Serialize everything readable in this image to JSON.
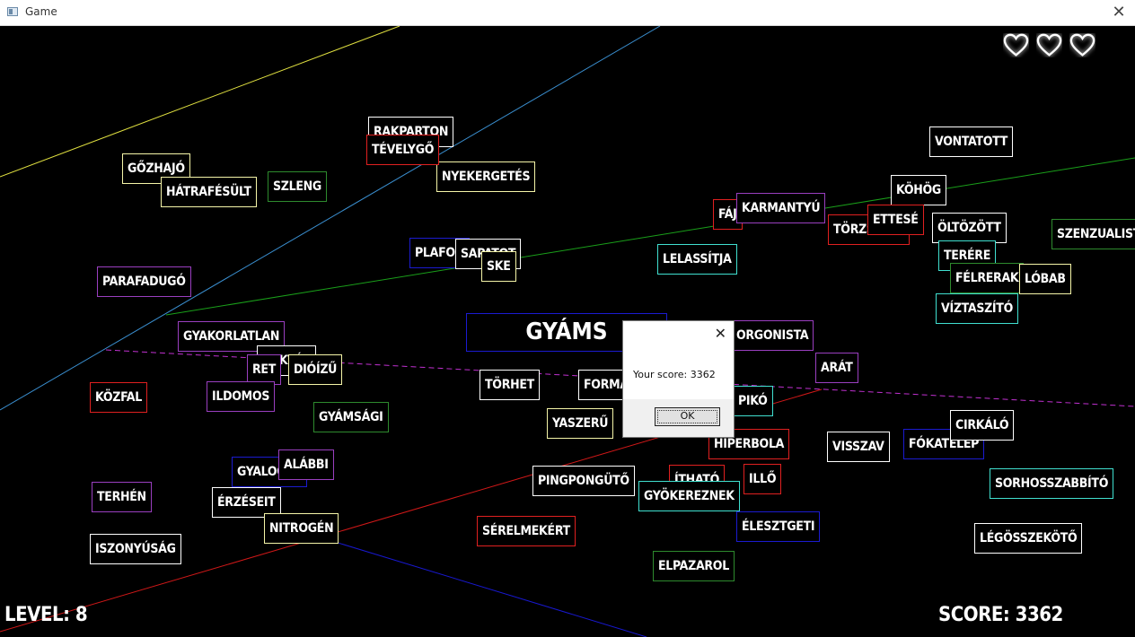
{
  "window": {
    "title": "Game",
    "close_glyph": "✕"
  },
  "hud": {
    "level_text": "LEVEL: 8",
    "score_text": "SCORE: 3362",
    "lives": 3,
    "heart_icon": "heart-outline-icon"
  },
  "current_word": "GYÁMS",
  "dialog": {
    "message": "Your score: 3362",
    "ok_label": "OK",
    "close_glyph": "✕"
  },
  "colors": {
    "background": "#000000",
    "white": "#ffffff",
    "yellow": "#f5f5a8",
    "green": "#2e8b2e",
    "red": "#e02020",
    "purple": "#9a3fc0",
    "cyan": "#40e0d0",
    "blue": "#1b1bd0"
  },
  "words": [
    {
      "text": "RAKPARTON",
      "color": "white"
    },
    {
      "text": "NYEKERGETÉS",
      "color": "yellow"
    },
    {
      "text": "TÉVELYGŐ",
      "color": "red"
    },
    {
      "text": "GŐZHAJÓ",
      "color": "yellow"
    },
    {
      "text": "HÁTRAFÉSÜLT",
      "color": "yellow"
    },
    {
      "text": "SZLENG",
      "color": "green"
    },
    {
      "text": "VONTATOTT",
      "color": "white"
    },
    {
      "text": "KÖHÖG",
      "color": "white"
    },
    {
      "text": "FÁJ",
      "color": "red"
    },
    {
      "text": "KARMANTYÚ",
      "color": "purple"
    },
    {
      "text": "TÖRZSHELY",
      "color": "red"
    },
    {
      "text": "ETTESÉ",
      "color": "red"
    },
    {
      "text": "ÖLTÖZÖTT",
      "color": "white"
    },
    {
      "text": "SZENZUALISTA",
      "color": "green"
    },
    {
      "text": "TERÉRE",
      "color": "cyan"
    },
    {
      "text": "FÉLRERAK",
      "color": "green"
    },
    {
      "text": "LÓBAB",
      "color": "yellow"
    },
    {
      "text": "VÍZTASZÍTÓ",
      "color": "cyan"
    },
    {
      "text": "PLAFON",
      "color": "blue"
    },
    {
      "text": "SAPATOT",
      "color": "white"
    },
    {
      "text": "SKE",
      "color": "yellow"
    },
    {
      "text": "LELASSÍTJA",
      "color": "cyan"
    },
    {
      "text": "PARAFADUGÓ",
      "color": "purple"
    },
    {
      "text": "GYAKORLATLAN",
      "color": "purple"
    },
    {
      "text": "RAKTÉR",
      "color": "white"
    },
    {
      "text": "RET",
      "color": "purple"
    },
    {
      "text": "DIÓÍZŰ",
      "color": "yellow"
    },
    {
      "text": "KÖZFAL",
      "color": "red"
    },
    {
      "text": "ILDOMOS",
      "color": "purple"
    },
    {
      "text": "GYÁMSÁGI",
      "color": "green"
    },
    {
      "text": "TÖRHET",
      "color": "white"
    },
    {
      "text": "FORMÁLISAN",
      "color": "white"
    },
    {
      "text": "YASZERŰ",
      "color": "yellow"
    },
    {
      "text": "ORGONISTA",
      "color": "purple"
    },
    {
      "text": "ARÁT",
      "color": "purple"
    },
    {
      "text": "PIKÓ",
      "color": "cyan"
    },
    {
      "text": "HIPERBOLA",
      "color": "red"
    },
    {
      "text": "VISSZAV",
      "color": "white"
    },
    {
      "text": "FÓKATELEP",
      "color": "blue"
    },
    {
      "text": "CIRKÁLÓ",
      "color": "white"
    },
    {
      "text": "SORHOSSZABBÍTÓ",
      "color": "cyan"
    },
    {
      "text": "TERHÉN",
      "color": "purple"
    },
    {
      "text": "GYALOGOL",
      "color": "blue"
    },
    {
      "text": "ALÁBBI",
      "color": "purple"
    },
    {
      "text": "ÉRZÉSEIT",
      "color": "white"
    },
    {
      "text": "NITROGÉN",
      "color": "yellow"
    },
    {
      "text": "PINGPONGÜTŐ",
      "color": "white"
    },
    {
      "text": "ÍTHATÓ",
      "color": "red"
    },
    {
      "text": "ILLŐ",
      "color": "red"
    },
    {
      "text": "GYÖKEREZNEK",
      "color": "cyan"
    },
    {
      "text": "ISZONYÚSÁG",
      "color": "white"
    },
    {
      "text": "SÉRELMEKÉRT",
      "color": "red"
    },
    {
      "text": "ÉLESZTGETI",
      "color": "blue"
    },
    {
      "text": "ELPAZAROL",
      "color": "green"
    },
    {
      "text": "LÉGÖSSZEKÖTŐ",
      "color": "white"
    }
  ]
}
